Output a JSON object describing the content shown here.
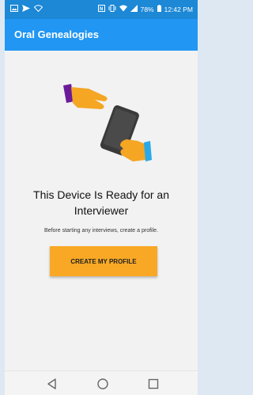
{
  "status_bar": {
    "battery": "78%",
    "time": "12:42 PM",
    "left_icons": [
      "image-icon",
      "send-icon",
      "wifi-outline-icon"
    ],
    "right_icons": [
      "nfc-icon",
      "vibrate-icon",
      "wifi-icon",
      "signal-icon",
      "battery-icon"
    ]
  },
  "app_bar": {
    "title": "Oral Genealogies"
  },
  "empty_state": {
    "illustration": "handing-phone-illustration",
    "headline": "This Device Is Ready for an Interviewer",
    "subtext": "Before starting any interviews, create a profile.",
    "button_label": "CREATE MY PROFILE"
  },
  "nav_bar": {
    "buttons": [
      "back-icon",
      "home-icon",
      "recents-icon"
    ]
  },
  "colors": {
    "status_bar": "#1c88d6",
    "app_bar": "#2196f3",
    "accent_button": "#f9a825",
    "background": "#f2f2f2"
  }
}
